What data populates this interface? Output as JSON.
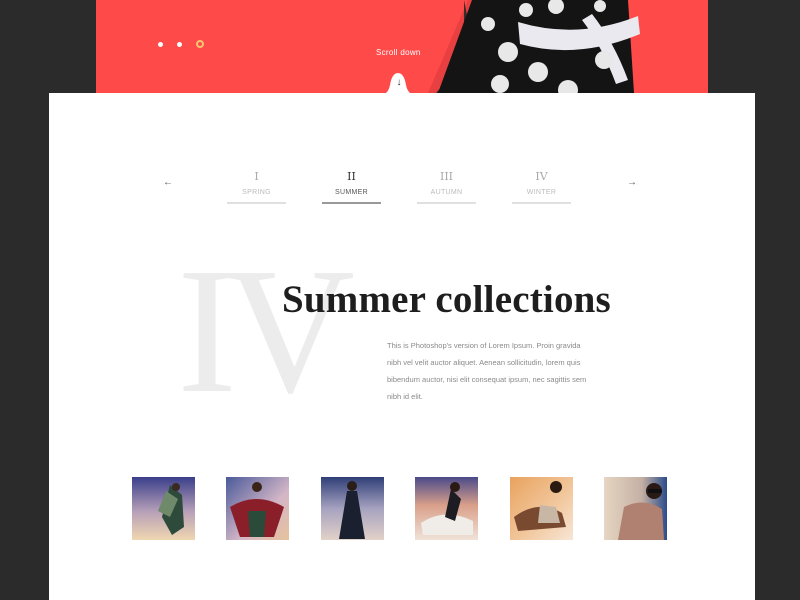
{
  "hero": {
    "scroll_label": "Scroll down",
    "slider_dots": 3,
    "active_dot": 2,
    "background_color": "#ff4a4a"
  },
  "nav": {
    "prev_icon": "arrow-left-icon",
    "next_icon": "arrow-right-icon",
    "seasons": [
      {
        "numeral": "I",
        "label": "SPRING"
      },
      {
        "numeral": "II",
        "label": "SUMMER",
        "active": true
      },
      {
        "numeral": "III",
        "label": "AUTUMN"
      },
      {
        "numeral": "IV",
        "label": "WINTER"
      }
    ]
  },
  "collection": {
    "background_numeral": "IV",
    "title": "Summer collections",
    "description": "This is Photoshop's version  of Lorem Ipsum. Proin gravida nibh vel velit auctor aliquet. Aenean sollicitudin, lorem quis bibendum auctor, nisi elit consequat ipsum, nec sagittis sem nibh id elit."
  },
  "gallery": {
    "thumb_count": 6
  }
}
